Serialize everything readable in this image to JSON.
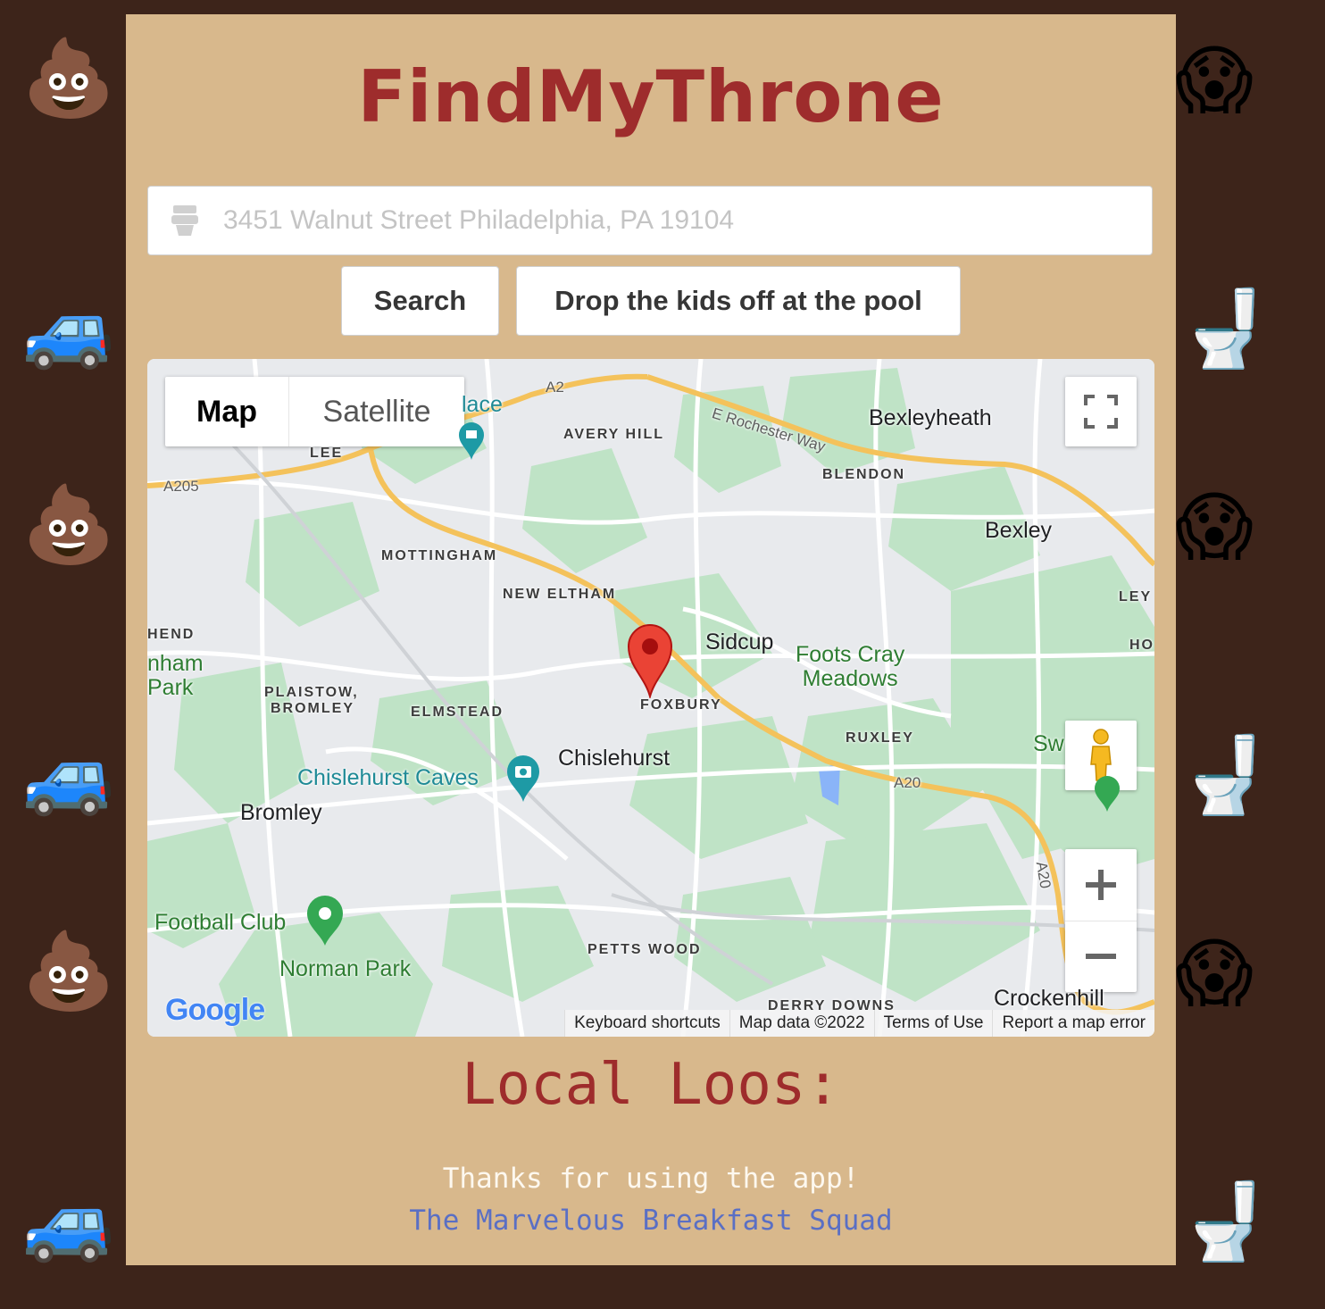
{
  "app": {
    "title": "FindMyThrone"
  },
  "search": {
    "placeholder": "3451 Walnut Street Philadelphia, PA 19104",
    "icon": "toilet-icon"
  },
  "buttons": {
    "search_label": "Search",
    "pool_label": "Drop the kids off at the pool"
  },
  "map": {
    "type_control": {
      "map_label": "Map",
      "satellite_label": "Satellite"
    },
    "labels": {
      "towns": [
        "Bexleyheath",
        "Bexley",
        "Sidcup",
        "Chislehurst",
        "Bromley",
        "Crockenhill"
      ],
      "areas": [
        "AVERY HILL",
        "BLENDON",
        "LEE",
        "MOTTINGHAM",
        "NEW ELTHAM",
        "FOXBURY",
        "RUXLEY",
        "PLAISTOW,",
        "BROMLEY",
        "ELMSTEAD",
        "PETTS WOOD",
        "DERRY DOWNS",
        "HEND",
        "LEY",
        "HO"
      ],
      "parks": [
        "Foots Cray",
        "Meadows",
        "Norman Park",
        "Football Club",
        "nham",
        "Park",
        "Sw"
      ],
      "pois": [
        "Chislehurst Caves",
        "lace"
      ],
      "roads": [
        "A2",
        "A205",
        "A20",
        "A20",
        "E Rochester Way"
      ]
    },
    "google_logo": "Google",
    "footer": {
      "keyboard": "Keyboard shortcuts",
      "data": "Map data ©2022",
      "terms": "Terms of Use",
      "report": "Report a map error"
    }
  },
  "results": {
    "heading": "Local Loos:"
  },
  "footer": {
    "thanks": "Thanks for using the app!",
    "team": "The Marvelous Breakfast Squad"
  },
  "decor": {
    "left_column": [
      "pile-of-poo",
      "car",
      "pile-of-poo",
      "car",
      "pile-of-poo",
      "car"
    ],
    "right_column": [
      "screaming-face",
      "toilet",
      "screaming-face",
      "toilet",
      "screaming-face",
      "toilet"
    ]
  },
  "colors": {
    "background": "#3d241a",
    "panel": "#d8b88c",
    "title": "#9e2c2c",
    "link": "#5a6fc4"
  }
}
